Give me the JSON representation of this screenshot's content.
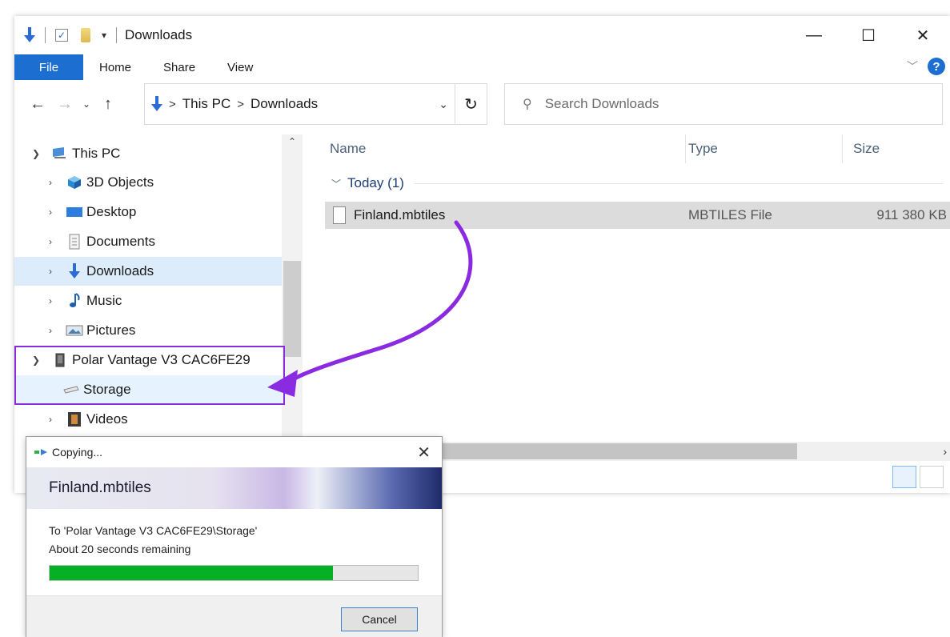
{
  "window": {
    "title": "Downloads",
    "controls": {
      "minimize": "—",
      "maximize": "☐",
      "close": "✕"
    }
  },
  "ribbon": {
    "tabs": [
      "File",
      "Home",
      "Share",
      "View"
    ]
  },
  "navigation": {
    "breadcrumb": [
      "This PC",
      "Downloads"
    ],
    "search_placeholder": "Search Downloads"
  },
  "sidebar": {
    "items": [
      {
        "label": "This PC",
        "icon": "computer-icon",
        "expanded": true
      },
      {
        "label": "3D Objects",
        "icon": "cube-icon"
      },
      {
        "label": "Desktop",
        "icon": "desktop-icon"
      },
      {
        "label": "Documents",
        "icon": "document-icon"
      },
      {
        "label": "Downloads",
        "icon": "download-icon",
        "selected": true
      },
      {
        "label": "Music",
        "icon": "music-note-icon"
      },
      {
        "label": "Pictures",
        "icon": "picture-icon"
      },
      {
        "label": "Polar Vantage V3 CAC6FE29",
        "icon": "device-icon",
        "expanded": true
      },
      {
        "label": "Storage",
        "icon": "drive-icon"
      },
      {
        "label": "Videos",
        "icon": "film-icon"
      }
    ]
  },
  "content": {
    "columns": [
      "Name",
      "Type",
      "Size"
    ],
    "group": "Today (1)",
    "files": [
      {
        "name": "Finland.mbtiles",
        "type": "MBTILES File",
        "size": "911 380 KB"
      }
    ]
  },
  "copy_dialog": {
    "title": "Copying...",
    "filename": "Finland.mbtiles",
    "destination": "To 'Polar Vantage V3 CAC6FE29\\Storage'",
    "remaining": "About 20 seconds remaining",
    "progress_fraction": 0.77,
    "cancel_label": "Cancel"
  },
  "colors": {
    "accent": "#1c6fd1",
    "annotation": "#8a2be2",
    "progress": "#06b025"
  }
}
